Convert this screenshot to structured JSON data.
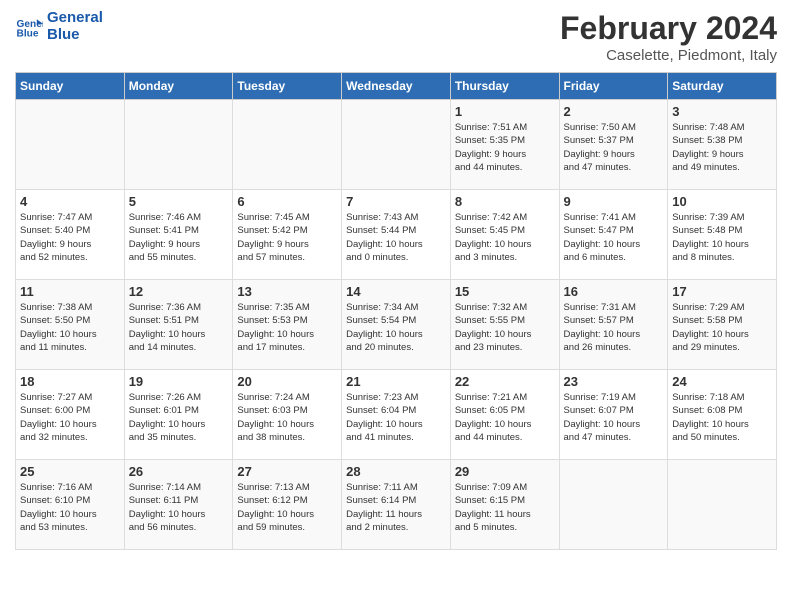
{
  "header": {
    "logo_line1": "General",
    "logo_line2": "Blue",
    "main_title": "February 2024",
    "subtitle": "Caselette, Piedmont, Italy"
  },
  "days_of_week": [
    "Sunday",
    "Monday",
    "Tuesday",
    "Wednesday",
    "Thursday",
    "Friday",
    "Saturday"
  ],
  "weeks": [
    [
      {
        "num": "",
        "info": ""
      },
      {
        "num": "",
        "info": ""
      },
      {
        "num": "",
        "info": ""
      },
      {
        "num": "",
        "info": ""
      },
      {
        "num": "1",
        "info": "Sunrise: 7:51 AM\nSunset: 5:35 PM\nDaylight: 9 hours\nand 44 minutes."
      },
      {
        "num": "2",
        "info": "Sunrise: 7:50 AM\nSunset: 5:37 PM\nDaylight: 9 hours\nand 47 minutes."
      },
      {
        "num": "3",
        "info": "Sunrise: 7:48 AM\nSunset: 5:38 PM\nDaylight: 9 hours\nand 49 minutes."
      }
    ],
    [
      {
        "num": "4",
        "info": "Sunrise: 7:47 AM\nSunset: 5:40 PM\nDaylight: 9 hours\nand 52 minutes."
      },
      {
        "num": "5",
        "info": "Sunrise: 7:46 AM\nSunset: 5:41 PM\nDaylight: 9 hours\nand 55 minutes."
      },
      {
        "num": "6",
        "info": "Sunrise: 7:45 AM\nSunset: 5:42 PM\nDaylight: 9 hours\nand 57 minutes."
      },
      {
        "num": "7",
        "info": "Sunrise: 7:43 AM\nSunset: 5:44 PM\nDaylight: 10 hours\nand 0 minutes."
      },
      {
        "num": "8",
        "info": "Sunrise: 7:42 AM\nSunset: 5:45 PM\nDaylight: 10 hours\nand 3 minutes."
      },
      {
        "num": "9",
        "info": "Sunrise: 7:41 AM\nSunset: 5:47 PM\nDaylight: 10 hours\nand 6 minutes."
      },
      {
        "num": "10",
        "info": "Sunrise: 7:39 AM\nSunset: 5:48 PM\nDaylight: 10 hours\nand 8 minutes."
      }
    ],
    [
      {
        "num": "11",
        "info": "Sunrise: 7:38 AM\nSunset: 5:50 PM\nDaylight: 10 hours\nand 11 minutes."
      },
      {
        "num": "12",
        "info": "Sunrise: 7:36 AM\nSunset: 5:51 PM\nDaylight: 10 hours\nand 14 minutes."
      },
      {
        "num": "13",
        "info": "Sunrise: 7:35 AM\nSunset: 5:53 PM\nDaylight: 10 hours\nand 17 minutes."
      },
      {
        "num": "14",
        "info": "Sunrise: 7:34 AM\nSunset: 5:54 PM\nDaylight: 10 hours\nand 20 minutes."
      },
      {
        "num": "15",
        "info": "Sunrise: 7:32 AM\nSunset: 5:55 PM\nDaylight: 10 hours\nand 23 minutes."
      },
      {
        "num": "16",
        "info": "Sunrise: 7:31 AM\nSunset: 5:57 PM\nDaylight: 10 hours\nand 26 minutes."
      },
      {
        "num": "17",
        "info": "Sunrise: 7:29 AM\nSunset: 5:58 PM\nDaylight: 10 hours\nand 29 minutes."
      }
    ],
    [
      {
        "num": "18",
        "info": "Sunrise: 7:27 AM\nSunset: 6:00 PM\nDaylight: 10 hours\nand 32 minutes."
      },
      {
        "num": "19",
        "info": "Sunrise: 7:26 AM\nSunset: 6:01 PM\nDaylight: 10 hours\nand 35 minutes."
      },
      {
        "num": "20",
        "info": "Sunrise: 7:24 AM\nSunset: 6:03 PM\nDaylight: 10 hours\nand 38 minutes."
      },
      {
        "num": "21",
        "info": "Sunrise: 7:23 AM\nSunset: 6:04 PM\nDaylight: 10 hours\nand 41 minutes."
      },
      {
        "num": "22",
        "info": "Sunrise: 7:21 AM\nSunset: 6:05 PM\nDaylight: 10 hours\nand 44 minutes."
      },
      {
        "num": "23",
        "info": "Sunrise: 7:19 AM\nSunset: 6:07 PM\nDaylight: 10 hours\nand 47 minutes."
      },
      {
        "num": "24",
        "info": "Sunrise: 7:18 AM\nSunset: 6:08 PM\nDaylight: 10 hours\nand 50 minutes."
      }
    ],
    [
      {
        "num": "25",
        "info": "Sunrise: 7:16 AM\nSunset: 6:10 PM\nDaylight: 10 hours\nand 53 minutes."
      },
      {
        "num": "26",
        "info": "Sunrise: 7:14 AM\nSunset: 6:11 PM\nDaylight: 10 hours\nand 56 minutes."
      },
      {
        "num": "27",
        "info": "Sunrise: 7:13 AM\nSunset: 6:12 PM\nDaylight: 10 hours\nand 59 minutes."
      },
      {
        "num": "28",
        "info": "Sunrise: 7:11 AM\nSunset: 6:14 PM\nDaylight: 11 hours\nand 2 minutes."
      },
      {
        "num": "29",
        "info": "Sunrise: 7:09 AM\nSunset: 6:15 PM\nDaylight: 11 hours\nand 5 minutes."
      },
      {
        "num": "",
        "info": ""
      },
      {
        "num": "",
        "info": ""
      }
    ]
  ]
}
